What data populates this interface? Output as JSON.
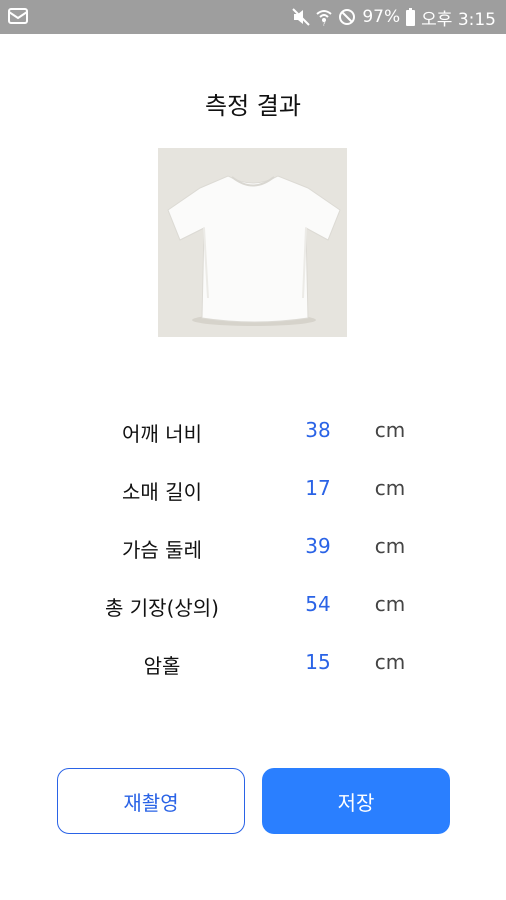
{
  "status_bar": {
    "battery": "97%",
    "time": "오후 3:15",
    "icons": [
      "mail-icon",
      "mute-icon",
      "wifi-icon",
      "do-not-disturb-icon",
      "battery-icon"
    ]
  },
  "page": {
    "title": "측정 결과"
  },
  "measurements": [
    {
      "label": "어깨 너비",
      "value": "38",
      "unit": "cm"
    },
    {
      "label": "소매 길이",
      "value": "17",
      "unit": "cm"
    },
    {
      "label": "가슴 둘레",
      "value": "39",
      "unit": "cm"
    },
    {
      "label": "총 기장(상의)",
      "value": "54",
      "unit": "cm"
    },
    {
      "label": "암홀",
      "value": "15",
      "unit": "cm"
    }
  ],
  "buttons": {
    "retake_label": "재촬영",
    "save_label": "저장"
  },
  "colors": {
    "accent": "#2a7fff",
    "value_text": "#2a63e6",
    "status_bar": "#9e9e9e"
  }
}
